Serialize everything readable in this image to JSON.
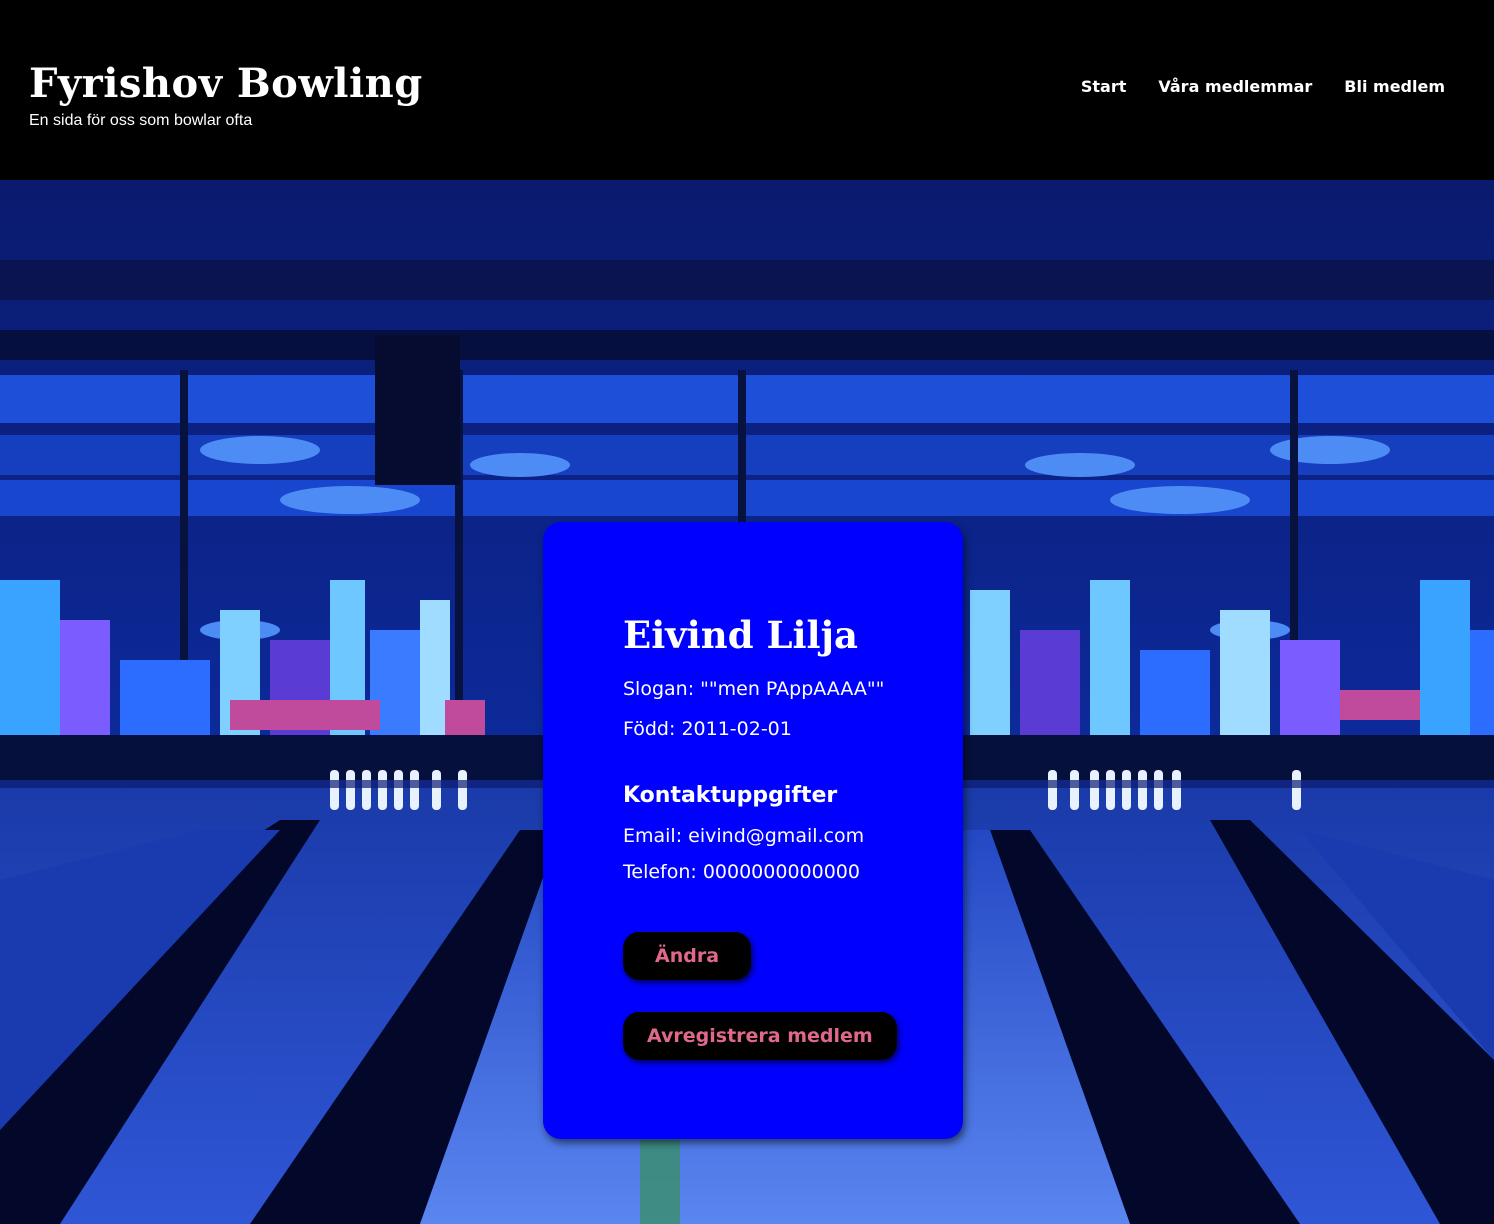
{
  "header": {
    "site_title": "Fyrishov Bowling",
    "tagline": "En sida för oss som bowlar ofta"
  },
  "nav": {
    "items": [
      {
        "label": "Start"
      },
      {
        "label": "Våra medlemmar"
      },
      {
        "label": "Bli medlem"
      }
    ]
  },
  "member": {
    "name": "Eivind Lilja",
    "slogan_line": "Slogan: \"\"men PAppAAAA\"\"",
    "born_line": "Född: 2011-02-01",
    "contact_heading": "Kontaktuppgifter",
    "email_line": "Email: eivind@gmail.com",
    "phone_line": "Telefon: 0000000000000"
  },
  "actions": {
    "edit_label": "Ändra",
    "unregister_label": "Avregistrera medlem"
  },
  "colors": {
    "header_bg": "#000000",
    "card_bg": "#0000ff",
    "button_bg": "#000000",
    "button_text": "#e0688a",
    "text": "#ffffff"
  }
}
